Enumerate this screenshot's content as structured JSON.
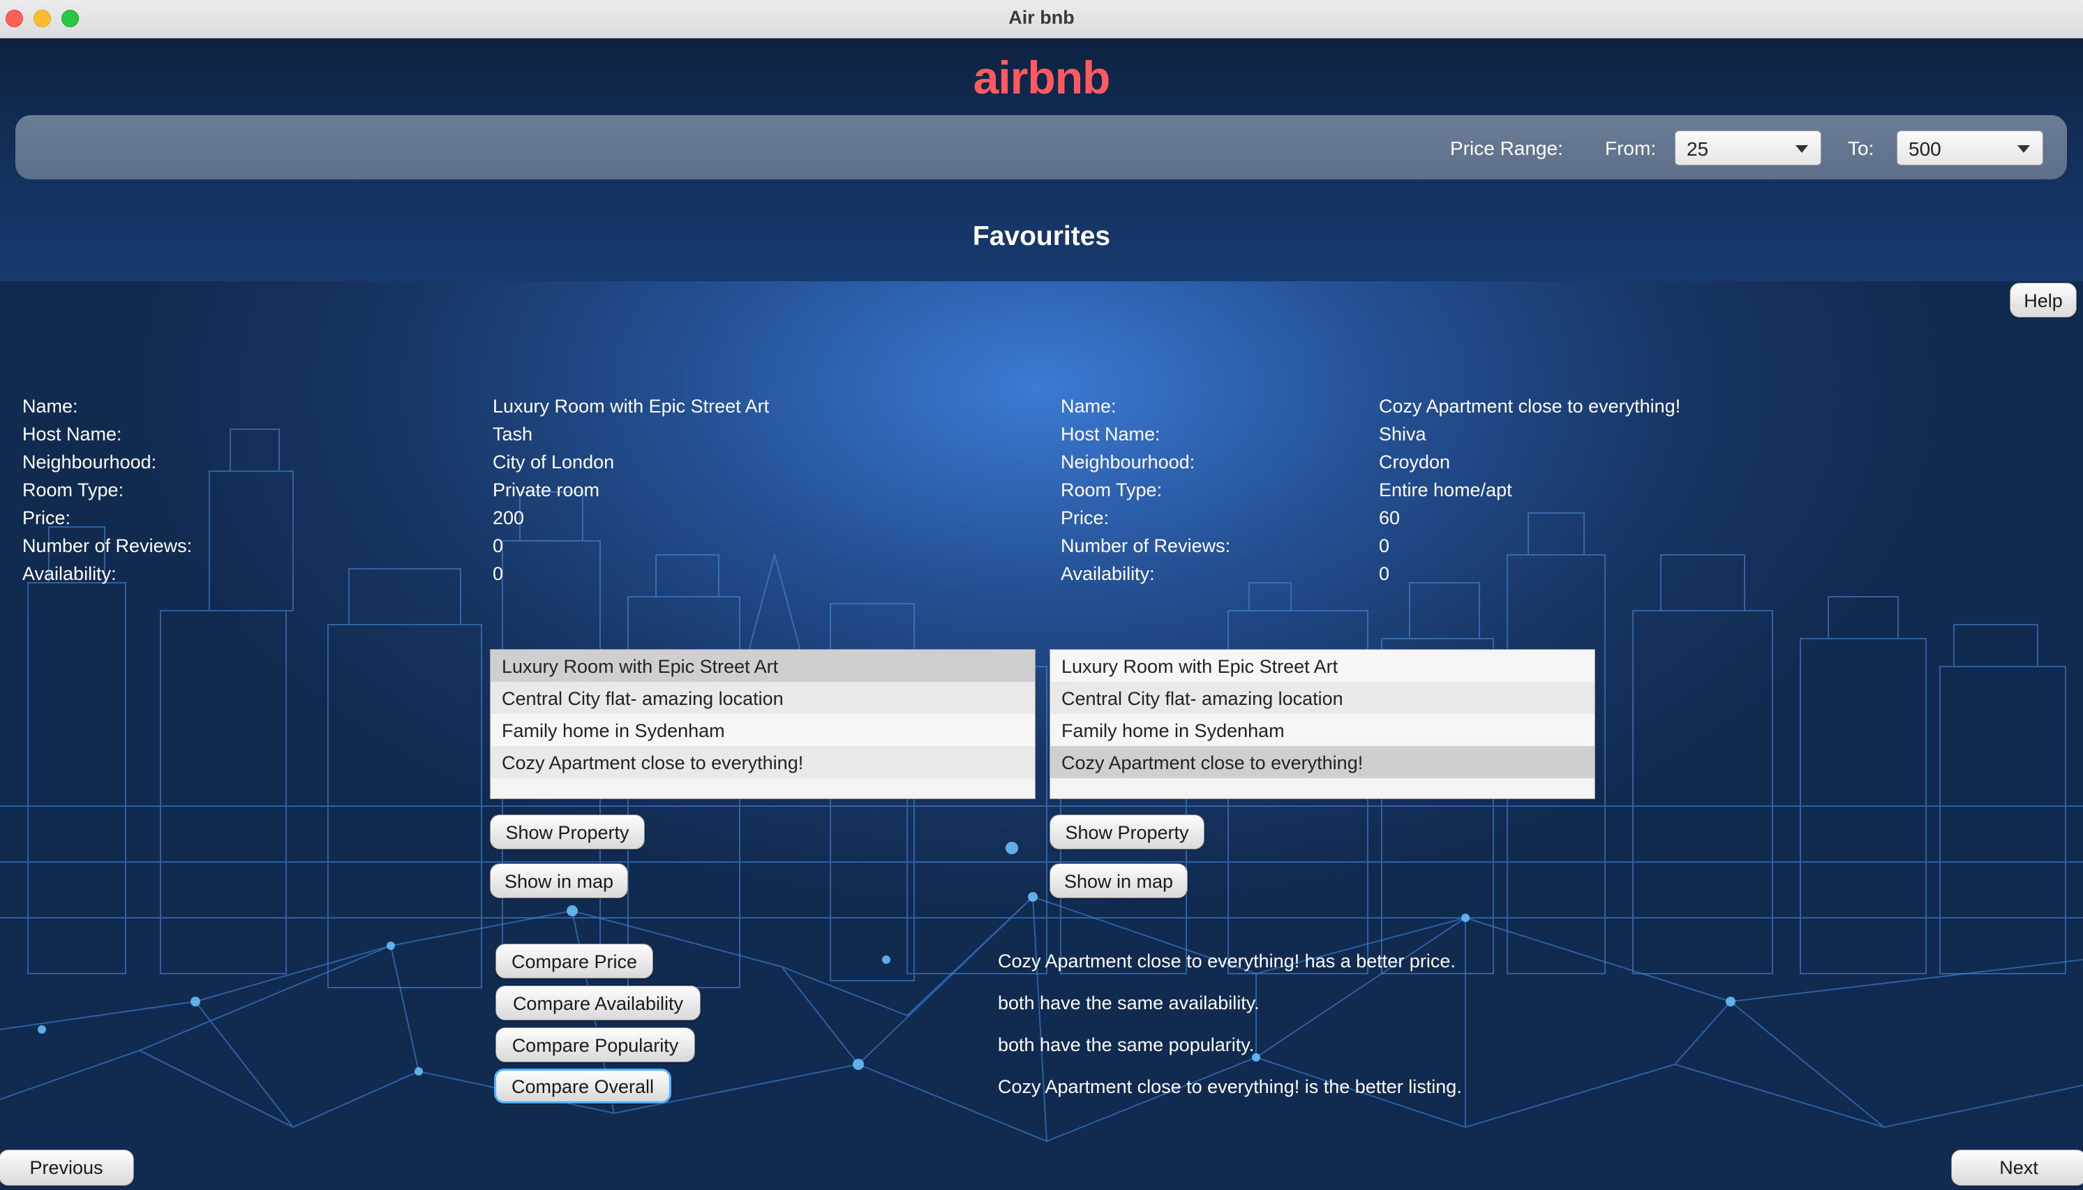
{
  "window": {
    "title": "Air bnb"
  },
  "header": {
    "logo": "airbnb",
    "price_range_label": "Price Range:",
    "from_label": "From:",
    "from_value": "25",
    "to_label": "To:",
    "to_value": "500",
    "page_title": "Favourites"
  },
  "help_label": "Help",
  "field_labels": [
    "Name:",
    "Host Name:",
    "Neighbourhood:",
    "Room Type:",
    "Price:",
    "Number of Reviews:",
    "Availability:"
  ],
  "left_property": [
    "Luxury Room with Epic Street Art",
    "Tash",
    "City of London",
    "Private room",
    "200",
    "0",
    "0"
  ],
  "right_property": [
    "Cozy Apartment close to everything!",
    "Shiva",
    "Croydon",
    "Entire home/apt",
    "60",
    "0",
    "0"
  ],
  "listings": [
    "Luxury Room with Epic Street Art",
    "Central City flat- amazing location",
    "Family home in Sydenham",
    "Cozy Apartment close to everything!"
  ],
  "left_selected": "Luxury Room with Epic Street Art",
  "right_selected": "Cozy Apartment close to everything!",
  "buttons": {
    "show_property": "Show Property",
    "show_in_map": "Show in map",
    "compare_price": "Compare Price",
    "compare_availability": "Compare Availability",
    "compare_popularity": "Compare Popularity",
    "compare_overall": "Compare Overall",
    "previous": "Previous",
    "next": "Next"
  },
  "results": [
    "Cozy Apartment close to everything! has a better price.",
    "both have the same availability.",
    "both have the same popularity.",
    "Cozy Apartment close to everything! is the better listing."
  ],
  "colors": {
    "brand": "#ff5a5f",
    "header": "#143260",
    "filter_bar": "#65778f",
    "focus_ring": "#4fb3ff"
  }
}
